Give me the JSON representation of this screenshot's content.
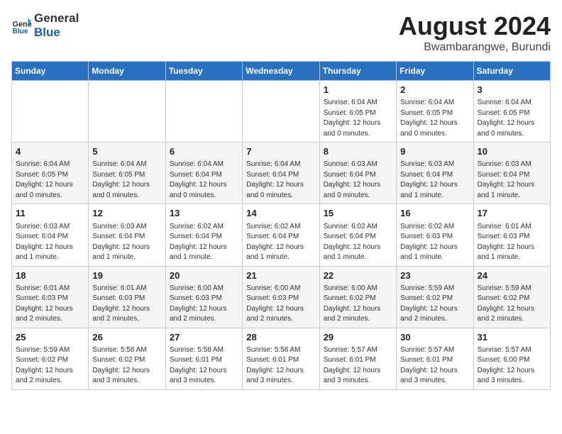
{
  "logo": {
    "line1": "General",
    "line2": "Blue"
  },
  "title": "August 2024",
  "subtitle": "Bwambarangwe, Burundi",
  "days_of_week": [
    "Sunday",
    "Monday",
    "Tuesday",
    "Wednesday",
    "Thursday",
    "Friday",
    "Saturday"
  ],
  "weeks": [
    [
      {
        "day": "",
        "info": ""
      },
      {
        "day": "",
        "info": ""
      },
      {
        "day": "",
        "info": ""
      },
      {
        "day": "",
        "info": ""
      },
      {
        "day": "1",
        "info": "Sunrise: 6:04 AM\nSunset: 6:05 PM\nDaylight: 12 hours\nand 0 minutes."
      },
      {
        "day": "2",
        "info": "Sunrise: 6:04 AM\nSunset: 6:05 PM\nDaylight: 12 hours\nand 0 minutes."
      },
      {
        "day": "3",
        "info": "Sunrise: 6:04 AM\nSunset: 6:05 PM\nDaylight: 12 hours\nand 0 minutes."
      }
    ],
    [
      {
        "day": "4",
        "info": "Sunrise: 6:04 AM\nSunset: 6:05 PM\nDaylight: 12 hours\nand 0 minutes."
      },
      {
        "day": "5",
        "info": "Sunrise: 6:04 AM\nSunset: 6:05 PM\nDaylight: 12 hours\nand 0 minutes."
      },
      {
        "day": "6",
        "info": "Sunrise: 6:04 AM\nSunset: 6:04 PM\nDaylight: 12 hours\nand 0 minutes."
      },
      {
        "day": "7",
        "info": "Sunrise: 6:04 AM\nSunset: 6:04 PM\nDaylight: 12 hours\nand 0 minutes."
      },
      {
        "day": "8",
        "info": "Sunrise: 6:03 AM\nSunset: 6:04 PM\nDaylight: 12 hours\nand 0 minutes."
      },
      {
        "day": "9",
        "info": "Sunrise: 6:03 AM\nSunset: 6:04 PM\nDaylight: 12 hours\nand 1 minute."
      },
      {
        "day": "10",
        "info": "Sunrise: 6:03 AM\nSunset: 6:04 PM\nDaylight: 12 hours\nand 1 minute."
      }
    ],
    [
      {
        "day": "11",
        "info": "Sunrise: 6:03 AM\nSunset: 6:04 PM\nDaylight: 12 hours\nand 1 minute."
      },
      {
        "day": "12",
        "info": "Sunrise: 6:03 AM\nSunset: 6:04 PM\nDaylight: 12 hours\nand 1 minute."
      },
      {
        "day": "13",
        "info": "Sunrise: 6:02 AM\nSunset: 6:04 PM\nDaylight: 12 hours\nand 1 minute."
      },
      {
        "day": "14",
        "info": "Sunrise: 6:02 AM\nSunset: 6:04 PM\nDaylight: 12 hours\nand 1 minute."
      },
      {
        "day": "15",
        "info": "Sunrise: 6:02 AM\nSunset: 6:04 PM\nDaylight: 12 hours\nand 1 minute."
      },
      {
        "day": "16",
        "info": "Sunrise: 6:02 AM\nSunset: 6:03 PM\nDaylight: 12 hours\nand 1 minute."
      },
      {
        "day": "17",
        "info": "Sunrise: 6:01 AM\nSunset: 6:03 PM\nDaylight: 12 hours\nand 1 minute."
      }
    ],
    [
      {
        "day": "18",
        "info": "Sunrise: 6:01 AM\nSunset: 6:03 PM\nDaylight: 12 hours\nand 2 minutes."
      },
      {
        "day": "19",
        "info": "Sunrise: 6:01 AM\nSunset: 6:03 PM\nDaylight: 12 hours\nand 2 minutes."
      },
      {
        "day": "20",
        "info": "Sunrise: 6:00 AM\nSunset: 6:03 PM\nDaylight: 12 hours\nand 2 minutes."
      },
      {
        "day": "21",
        "info": "Sunrise: 6:00 AM\nSunset: 6:03 PM\nDaylight: 12 hours\nand 2 minutes."
      },
      {
        "day": "22",
        "info": "Sunrise: 6:00 AM\nSunset: 6:02 PM\nDaylight: 12 hours\nand 2 minutes."
      },
      {
        "day": "23",
        "info": "Sunrise: 5:59 AM\nSunset: 6:02 PM\nDaylight: 12 hours\nand 2 minutes."
      },
      {
        "day": "24",
        "info": "Sunrise: 5:59 AM\nSunset: 6:02 PM\nDaylight: 12 hours\nand 2 minutes."
      }
    ],
    [
      {
        "day": "25",
        "info": "Sunrise: 5:59 AM\nSunset: 6:02 PM\nDaylight: 12 hours\nand 2 minutes."
      },
      {
        "day": "26",
        "info": "Sunrise: 5:58 AM\nSunset: 6:02 PM\nDaylight: 12 hours\nand 3 minutes."
      },
      {
        "day": "27",
        "info": "Sunrise: 5:58 AM\nSunset: 6:01 PM\nDaylight: 12 hours\nand 3 minutes."
      },
      {
        "day": "28",
        "info": "Sunrise: 5:58 AM\nSunset: 6:01 PM\nDaylight: 12 hours\nand 3 minutes."
      },
      {
        "day": "29",
        "info": "Sunrise: 5:57 AM\nSunset: 6:01 PM\nDaylight: 12 hours\nand 3 minutes."
      },
      {
        "day": "30",
        "info": "Sunrise: 5:57 AM\nSunset: 6:01 PM\nDaylight: 12 hours\nand 3 minutes."
      },
      {
        "day": "31",
        "info": "Sunrise: 5:57 AM\nSunset: 6:00 PM\nDaylight: 12 hours\nand 3 minutes."
      }
    ]
  ]
}
